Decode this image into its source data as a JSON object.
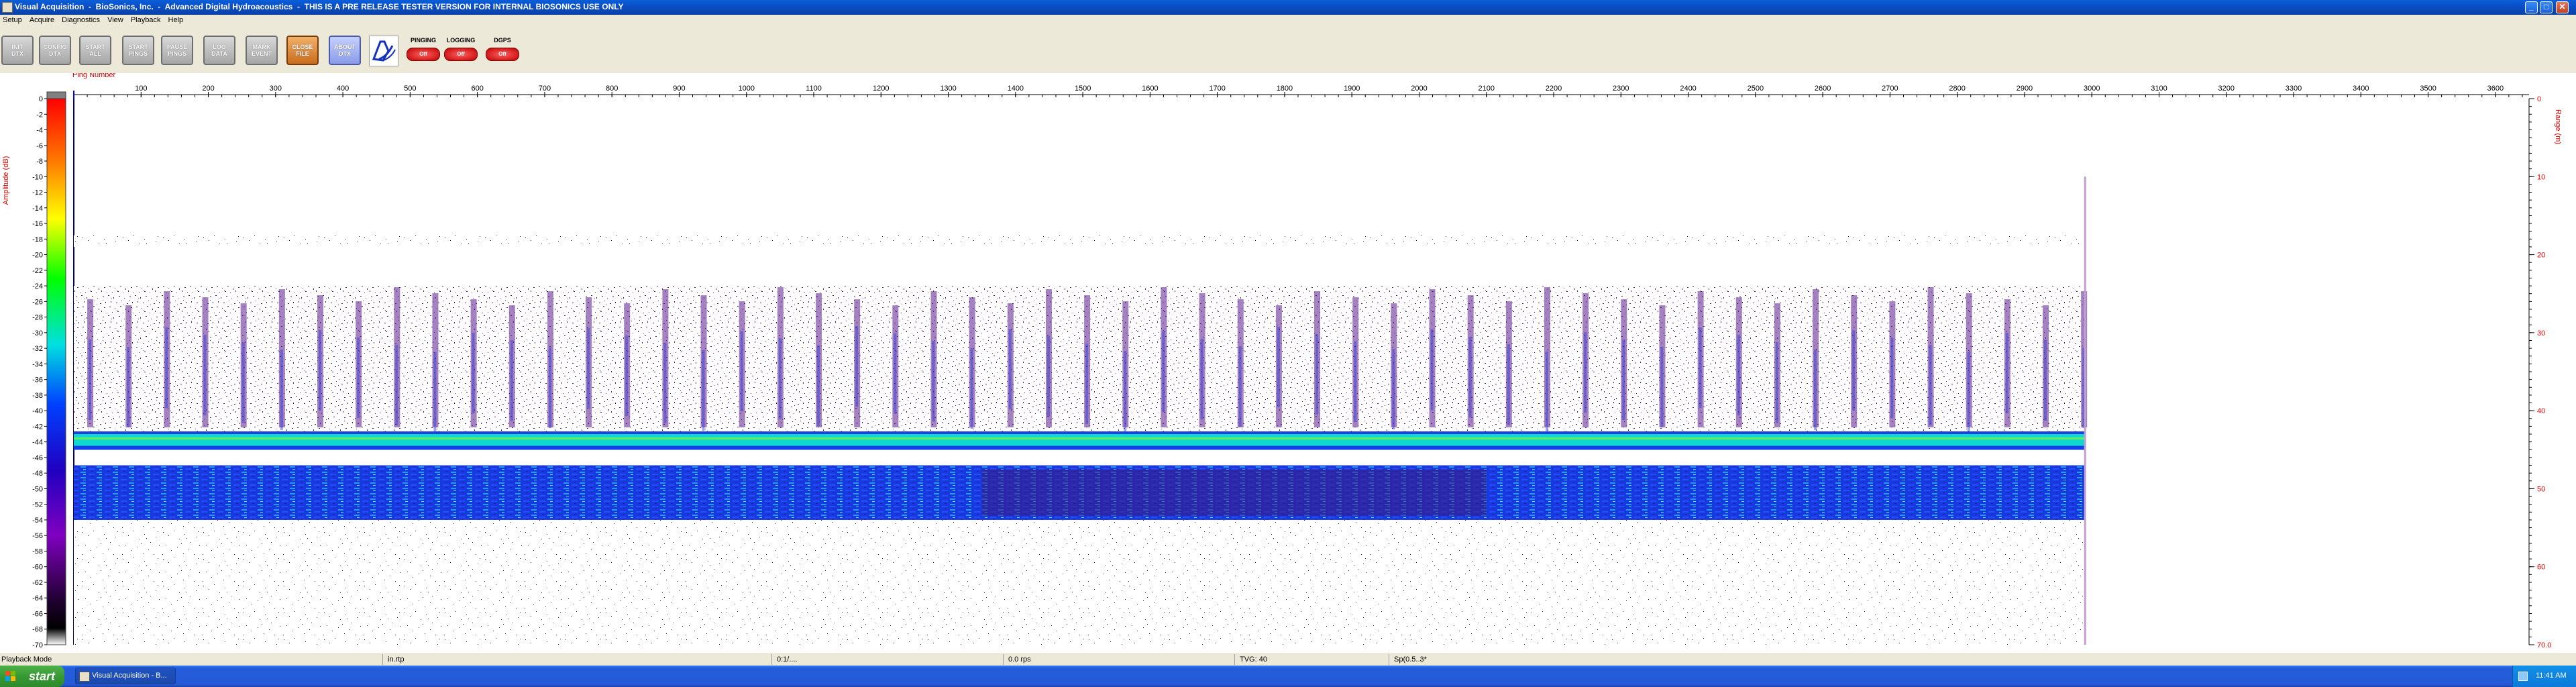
{
  "window": {
    "title": "Visual Acquisition  -  BioSonics, Inc.  -  Advanced Digital Hydroacoustics  -  THIS IS A PRE RELEASE TESTER VERSION FOR INTERNAL BIOSONICS USE ONLY",
    "min": "_",
    "max": "□",
    "close": "✕"
  },
  "menu": [
    "Setup",
    "Acquire",
    "Diagnostics",
    "View",
    "Playback",
    "Help"
  ],
  "toolbar": {
    "buttons": [
      {
        "l1": "INIT",
        "l2": "DTX",
        "style": "gray"
      },
      {
        "l1": "CONFIG",
        "l2": "DTX",
        "style": "gray"
      },
      {
        "l1": "START",
        "l2": "ALL",
        "style": "gray"
      },
      {
        "l1": "START",
        "l2": "PINGS",
        "style": "gray"
      },
      {
        "l1": "PAUSE",
        "l2": "PINGS",
        "style": "gray"
      },
      {
        "l1": "LOG",
        "l2": "DATA",
        "style": "gray"
      },
      {
        "l1": "MARK",
        "l2": "EVENT",
        "style": "gray"
      },
      {
        "l1": "CLOSE",
        "l2": "FILE",
        "style": "orange"
      },
      {
        "l1": "ABOUT",
        "l2": "DTX",
        "style": "blue"
      }
    ],
    "indicators": [
      {
        "label": "PINGING",
        "state": "Off"
      },
      {
        "label": "LOGGING",
        "state": "Off"
      },
      {
        "label": "DGPS",
        "state": "Off"
      }
    ]
  },
  "chart_data": {
    "type": "heatmap",
    "title": "",
    "xlabel": "Ping Number",
    "ylabel_left": "Amplitude (dB)",
    "ylabel_right": "Range (m)",
    "x_ticks": [
      100,
      200,
      300,
      400,
      500,
      600,
      700,
      800,
      900,
      1000,
      1100,
      1200,
      1300,
      1400,
      1500,
      1600,
      1700,
      1800,
      1900,
      2000,
      2100,
      2200,
      2300,
      2400,
      2500,
      2600,
      2700,
      2800,
      2900,
      3000,
      3100,
      3200,
      3300,
      3400,
      3500,
      3600
    ],
    "xlim": [
      0,
      3650
    ],
    "data_extent_pings": [
      0,
      2990
    ],
    "range_ticks": [
      {
        "value": 0,
        "label": "0"
      },
      {
        "value": 10,
        "label": "10"
      },
      {
        "value": 20,
        "label": "20"
      },
      {
        "value": 30,
        "label": "30"
      },
      {
        "value": 40,
        "label": "40"
      },
      {
        "value": 50,
        "label": "50"
      },
      {
        "value": 60,
        "label": "60"
      },
      {
        "value": 70,
        "label": "70.0"
      }
    ],
    "ylim_range_m": [
      0,
      70
    ],
    "colorbar_ticks": [
      0,
      -2,
      -4,
      -6,
      -8,
      -10,
      -12,
      -14,
      -16,
      -18,
      -20,
      -22,
      -24,
      -26,
      -28,
      -30,
      -32,
      -34,
      -36,
      -38,
      -40,
      -42,
      -44,
      -46,
      -48,
      -50,
      -52,
      -54,
      -56,
      -58,
      -60,
      -62,
      -64,
      -66,
      -68,
      -70
    ],
    "colorbar_range_db": [
      0,
      -70
    ],
    "layers": [
      {
        "name": "surface noise band",
        "range_m": [
          17.5,
          19.0
        ],
        "level_db": -68
      },
      {
        "name": "fish schools",
        "range_m": [
          24,
          43
        ],
        "level_db": -62
      },
      {
        "name": "strong layer",
        "range_m": [
          43,
          44.5
        ],
        "level_db": -40
      },
      {
        "name": "second layer",
        "range_m": [
          47,
          54
        ],
        "level_db": -50
      },
      {
        "name": "background noise",
        "range_m": [
          54,
          70
        ],
        "level_db": -70
      }
    ]
  },
  "statusbar": {
    "mode": "Playback Mode",
    "unit": "in.rtp",
    "pos": "0:1/....",
    "file": "0.0 rps",
    "tvg": "TVG: 40",
    "sp": "Sp(0.5..3*"
  },
  "taskbar": {
    "start": "start",
    "app": "Visual Acquisition  -  B...",
    "clock": "11:41 AM"
  }
}
